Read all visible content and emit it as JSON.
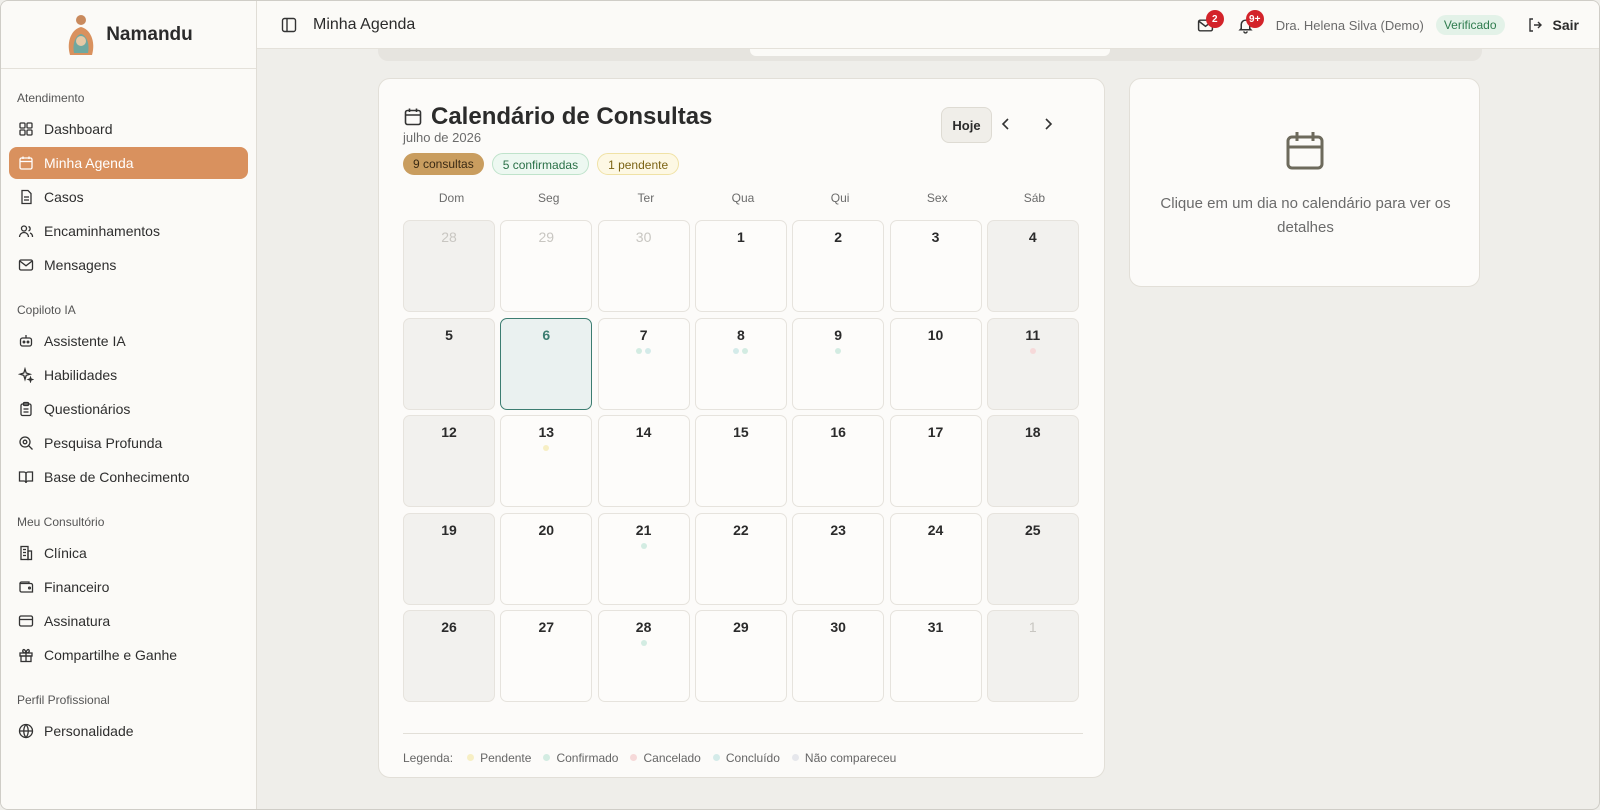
{
  "brand": {
    "name": "Namandu"
  },
  "header": {
    "title": "Minha Agenda",
    "mail_badge": "2",
    "bell_badge": "9+",
    "user": "Dra. Helena Silva (Demo)",
    "verified": "Verificado",
    "logout": "Sair"
  },
  "sidebar": {
    "sections": [
      {
        "title": "Atendimento",
        "items": [
          {
            "label": "Dashboard",
            "icon": "dashboard-icon"
          },
          {
            "label": "Minha Agenda",
            "icon": "calendar-icon",
            "active": true
          },
          {
            "label": "Casos",
            "icon": "document-icon"
          },
          {
            "label": "Encaminhamentos",
            "icon": "users-icon"
          },
          {
            "label": "Mensagens",
            "icon": "mail-icon"
          }
        ]
      },
      {
        "title": "Copiloto IA",
        "items": [
          {
            "label": "Assistente IA",
            "icon": "bot-icon"
          },
          {
            "label": "Habilidades",
            "icon": "sparkles-icon"
          },
          {
            "label": "Questionários",
            "icon": "clipboard-icon"
          },
          {
            "label": "Pesquisa Profunda",
            "icon": "search-zoom-icon"
          },
          {
            "label": "Base de Conhecimento",
            "icon": "book-icon"
          }
        ]
      },
      {
        "title": "Meu Consultório",
        "items": [
          {
            "label": "Clínica",
            "icon": "building-icon"
          },
          {
            "label": "Financeiro",
            "icon": "wallet-icon"
          },
          {
            "label": "Assinatura",
            "icon": "credit-card-icon"
          },
          {
            "label": "Compartilhe e Ganhe",
            "icon": "gift-icon"
          }
        ]
      },
      {
        "title": "Perfil Profissional",
        "items": [
          {
            "label": "Personalidade",
            "icon": "globe-icon"
          }
        ]
      }
    ]
  },
  "calendar": {
    "title": "Calendário de Consultas",
    "month": "julho de 2026",
    "pills": {
      "total": "9 consultas",
      "confirmed": "5 confirmadas",
      "pending": "1 pendente"
    },
    "today_label": "Hoje",
    "weekdays": [
      "Dom",
      "Seg",
      "Ter",
      "Qua",
      "Qui",
      "Sex",
      "Sáb"
    ],
    "days": [
      {
        "n": "28",
        "other": true
      },
      {
        "n": "29",
        "other": true
      },
      {
        "n": "30",
        "other": true
      },
      {
        "n": "1"
      },
      {
        "n": "2"
      },
      {
        "n": "3"
      },
      {
        "n": "4"
      },
      {
        "n": "5"
      },
      {
        "n": "6",
        "today": true
      },
      {
        "n": "7",
        "dots": [
          "confirmed",
          "concluded"
        ]
      },
      {
        "n": "8",
        "dots": [
          "concluded",
          "confirmed"
        ]
      },
      {
        "n": "9",
        "dots": [
          "confirmed"
        ]
      },
      {
        "n": "10"
      },
      {
        "n": "11",
        "dots": [
          "cancelled"
        ]
      },
      {
        "n": "12"
      },
      {
        "n": "13",
        "dots": [
          "pending"
        ]
      },
      {
        "n": "14"
      },
      {
        "n": "15"
      },
      {
        "n": "16"
      },
      {
        "n": "17"
      },
      {
        "n": "18"
      },
      {
        "n": "19"
      },
      {
        "n": "20"
      },
      {
        "n": "21",
        "dots": [
          "confirmed"
        ]
      },
      {
        "n": "22"
      },
      {
        "n": "23"
      },
      {
        "n": "24"
      },
      {
        "n": "25"
      },
      {
        "n": "26"
      },
      {
        "n": "27"
      },
      {
        "n": "28",
        "dots": [
          "confirmed"
        ]
      },
      {
        "n": "29"
      },
      {
        "n": "30"
      },
      {
        "n": "31"
      },
      {
        "n": "1",
        "other": true
      }
    ],
    "legend_label": "Legenda:",
    "legend": [
      {
        "key": "pending",
        "label": "Pendente",
        "color": "#f7efc4"
      },
      {
        "key": "confirmed",
        "label": "Confirmado",
        "color": "#d3ece2"
      },
      {
        "key": "cancelled",
        "label": "Cancelado",
        "color": "#f6d9d9"
      },
      {
        "key": "concluded",
        "label": "Concluído",
        "color": "#d4ebe9"
      },
      {
        "key": "noshow",
        "label": "Não compareceu",
        "color": "#e6e7ec"
      }
    ]
  },
  "details": {
    "empty_text": "Clique em um dia no calendário para ver os detalhes"
  },
  "colors": {
    "accent": "#d9915e",
    "today": "#3c7d71",
    "badge": "#d3232a"
  }
}
